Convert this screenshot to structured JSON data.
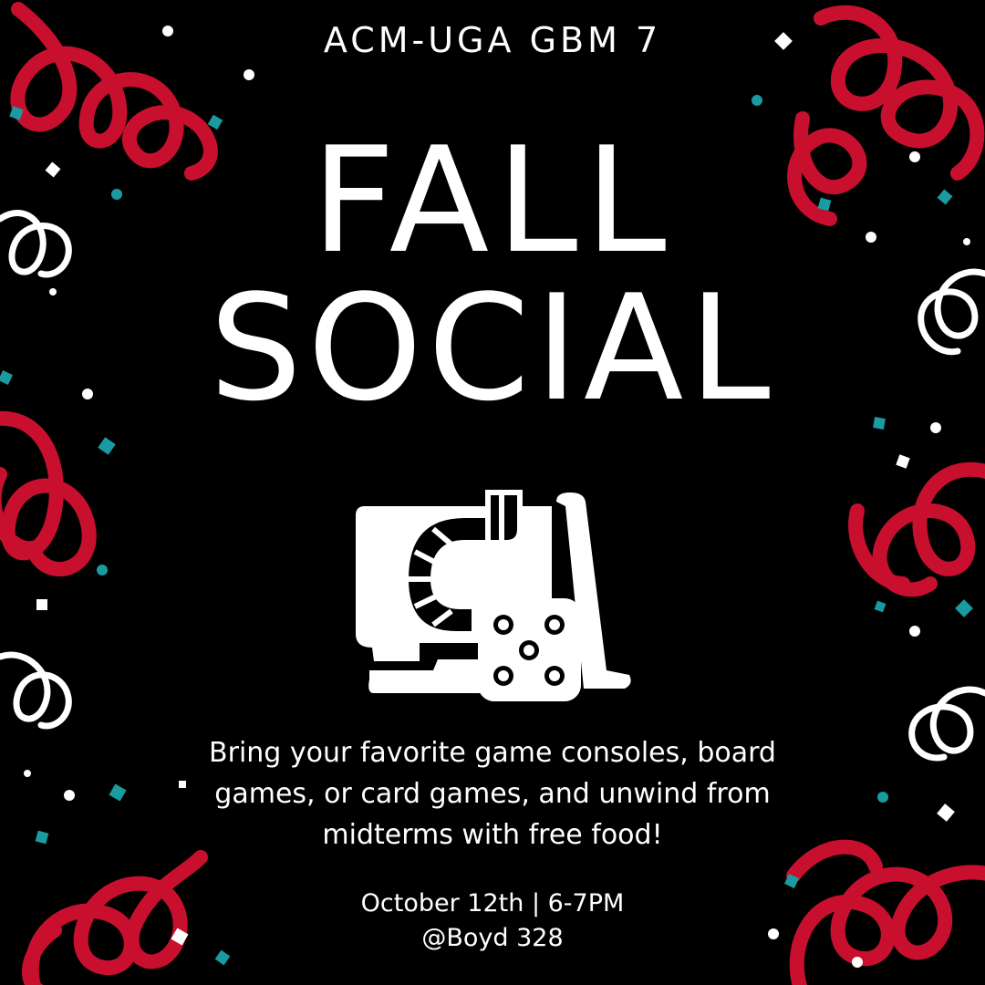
{
  "poster": {
    "subtitle": "ACM-UGA GBM 7",
    "title_line_1": "FALL",
    "title_line_2": "SOCIAL",
    "description": "Bring your favorite game consoles, board games, or card games, and unwind from midterms with free food!",
    "date_time": "October 12th | 6-7PM",
    "location": "@Boyd 328",
    "icon": "board-game-dice-icon"
  },
  "colors": {
    "background": "#000000",
    "text": "#ffffff",
    "ribbon_red": "#c8102e",
    "confetti_teal": "#1a9ba1",
    "confetti_white": "#ffffff"
  }
}
